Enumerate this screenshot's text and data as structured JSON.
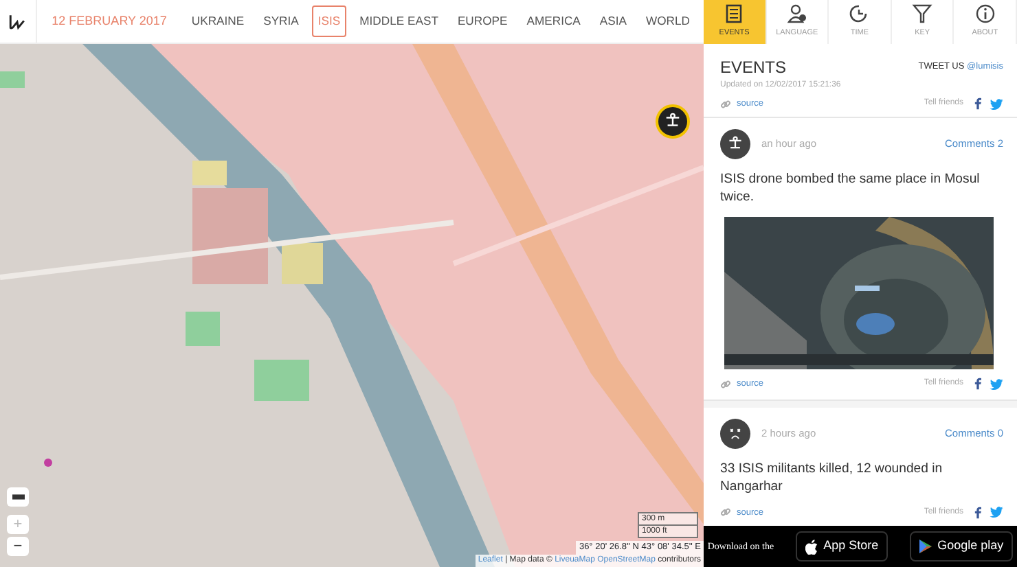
{
  "header": {
    "date": "12 FEBRUARY 2017",
    "regions": [
      {
        "label": "UKRAINE",
        "selected": false
      },
      {
        "label": "SYRIA",
        "selected": false
      },
      {
        "label": "ISIS",
        "selected": true
      },
      {
        "label": "MIDDLE EAST",
        "selected": false
      },
      {
        "label": "EUROPE",
        "selected": false
      },
      {
        "label": "AMERICA",
        "selected": false
      },
      {
        "label": "ASIA",
        "selected": false
      },
      {
        "label": "WORLD",
        "selected": false
      }
    ]
  },
  "map": {
    "zoom": [
      {
        "label": "+",
        "disabled": true
      },
      {
        "label": "−",
        "disabled": false
      }
    ],
    "scale_metric": "300 m",
    "scale_imperial": "1000 ft",
    "coordinates": "36° 20' 26.8'' N 43° 08' 34.5'' E",
    "attribution": [
      {
        "text": "Leaflet",
        "link": true
      },
      {
        "text": "| Map data ©",
        "link": false
      },
      {
        "text": "LiveuaMap",
        "link": true
      },
      {
        "text": "OpenStreetMap",
        "link": true
      },
      {
        "text": "contributors",
        "link": false
      }
    ]
  },
  "panel_tabs": [
    {
      "kind": "events",
      "label": "EVENTS",
      "selected": true
    },
    {
      "kind": "language",
      "label": "LANGUAGE",
      "selected": false
    },
    {
      "kind": "time",
      "label": "TIME",
      "selected": false
    },
    {
      "kind": "key",
      "label": "KEY",
      "selected": false
    },
    {
      "kind": "about",
      "label": "ABOUT",
      "selected": false
    }
  ],
  "events_header": {
    "title": "EVENTS",
    "tweet_label": "TWEET US",
    "tweet_handle": "@lumisis",
    "updated": "Updated on 12/02/2017 15:21:36",
    "source": "source",
    "tell_friends": "Tell friends"
  },
  "events": [
    {
      "kind": "drone",
      "time": "an hour ago",
      "comments": "Comments 2",
      "text": "ISIS drone bombed the same place in Mosul twice.",
      "source": "source",
      "tell_friends": "Tell friends"
    },
    {
      "kind": "dead",
      "time": "2 hours ago",
      "comments": "Comments 0",
      "text": "33 ISIS militants killed, 12 wounded in Nangarhar",
      "source": "source",
      "tell_friends": "Tell friends"
    }
  ],
  "app_bar": {
    "label": "Download on the",
    "app_store": "App Store",
    "google_play": "Google play"
  }
}
